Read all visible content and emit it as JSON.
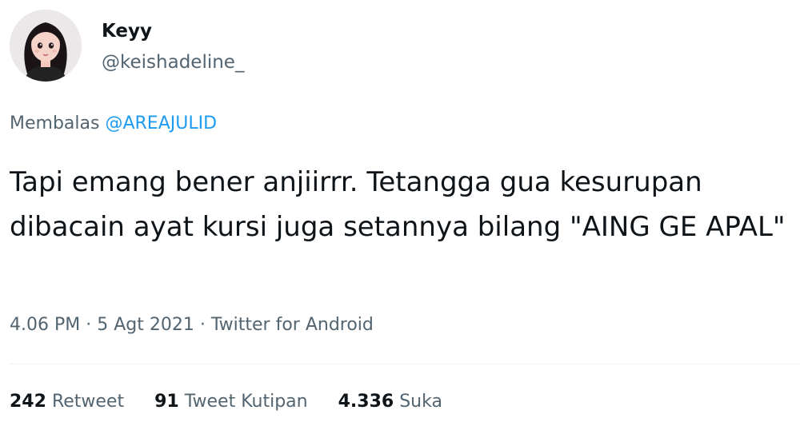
{
  "user": {
    "display_name": "Keyy",
    "handle": "@keishadeline_"
  },
  "reply": {
    "prefix": "Membalas",
    "mention": "@AREAJULID"
  },
  "tweet": {
    "text": "Tapi emang bener anjiirrr. Tetangga gua kesurupan dibacain ayat kursi juga setannya bilang \"AING GE APAL\""
  },
  "meta": {
    "time": "4.06 PM",
    "date": "5 Agt 2021",
    "source": "Twitter for Android",
    "separator": "·"
  },
  "stats": {
    "retweets": "242",
    "retweets_label": "Retweet",
    "quotes": "91",
    "quotes_label": "Tweet Kutipan",
    "likes": "4.336",
    "likes_label": "Suka"
  },
  "colors": {
    "text": "#0f1419",
    "secondary": "#536471",
    "link": "#1d9bf0"
  }
}
